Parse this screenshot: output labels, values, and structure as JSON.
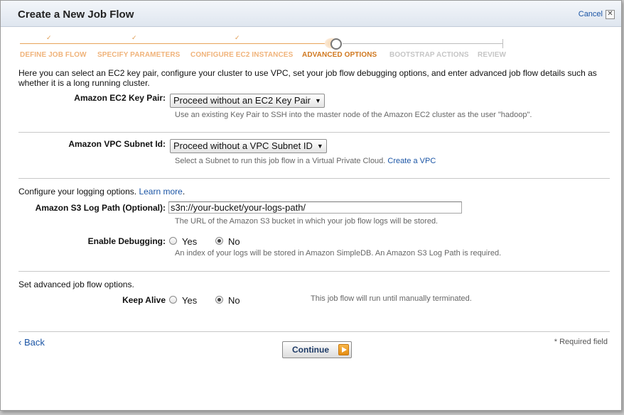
{
  "dialog": {
    "title": "Create a New Job Flow",
    "cancel_label": "Cancel",
    "close_glyph": "✕"
  },
  "wizard": {
    "steps": [
      {
        "label": "DEFINE JOB FLOW",
        "status": "done"
      },
      {
        "label": "SPECIFY PARAMETERS",
        "status": "done"
      },
      {
        "label": "CONFIGURE EC2 INSTANCES",
        "status": "done"
      },
      {
        "label": "ADVANCED OPTIONS",
        "status": "current"
      },
      {
        "label": "BOOTSTRAP ACTIONS",
        "status": "todo"
      },
      {
        "label": "REVIEW",
        "status": "todo"
      }
    ],
    "check_glyph": "✓"
  },
  "intro": "Here you can select an EC2 key pair, configure your cluster to use VPC, set your job flow debugging options, and enter advanced job flow details such as whether it is a long running cluster.",
  "key_pair": {
    "label": "Amazon EC2 Key Pair:",
    "selected": "Proceed without an EC2 Key Pair",
    "help": "Use an existing Key Pair to SSH into the master node of the Amazon EC2 cluster as the user \"hadoop\"."
  },
  "vpc": {
    "label": "Amazon VPC Subnet Id:",
    "selected": "Proceed without a VPC Subnet ID",
    "help": "Select a Subnet to run this job flow in a Virtual Private Cloud.",
    "help_link": "Create a VPC"
  },
  "logging": {
    "intro": "Configure your logging options.",
    "learn_more": "Learn more",
    "learn_more_suffix": ".",
    "log_path_label": "Amazon S3 Log Path (Optional):",
    "log_path_value": "s3n://your-bucket/your-logs-path/",
    "log_path_help": "The URL of the Amazon S3 bucket in which your job flow logs will be stored.",
    "debugging_label": "Enable Debugging:",
    "yes": "Yes",
    "no": "No",
    "debugging_selected": "No",
    "debugging_help": "An index of your logs will be stored in Amazon SimpleDB. An Amazon S3 Log Path is required."
  },
  "advanced": {
    "intro": "Set advanced job flow options.",
    "keep_alive_label": "Keep Alive",
    "yes": "Yes",
    "no": "No",
    "keep_alive_selected": "No",
    "keep_alive_help": "This job flow will run until manually terminated."
  },
  "footer": {
    "back_label": "‹ Back",
    "continue_label": "Continue",
    "required_note": "* Required field"
  },
  "colors": {
    "step_done": "#f0b37a",
    "step_current": "#d0781f",
    "step_todo": "#c5c5c5",
    "link": "#1b55a5",
    "continue_arrow": "#e48c12"
  }
}
